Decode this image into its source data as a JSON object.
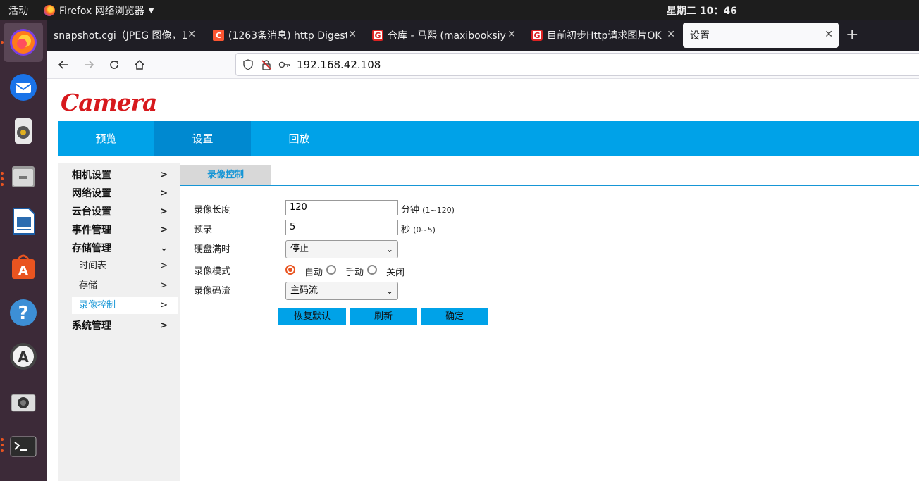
{
  "topbar": {
    "activities": "活动",
    "app_name": "Firefox 网络浏览器",
    "clock": "星期二 10：46"
  },
  "dock": {
    "items": [
      "firefox-icon",
      "thunderbird-icon",
      "rhythmbox-icon",
      "files-icon",
      "libreoffice-writer-icon",
      "software-center-icon",
      "help-icon",
      "software-updater-icon",
      "camera-icon",
      "terminal-icon"
    ]
  },
  "browser": {
    "tabs": [
      {
        "label": "snapshot.cgi（JPEG 图像，1",
        "favicon": ""
      },
      {
        "label": "(1263条消息) http Digest",
        "favicon": "C"
      },
      {
        "label": "仓库 - 马熙 (maxibooksiy",
        "favicon": "G"
      },
      {
        "label": "目前初步Http请求图片OK",
        "favicon": "G"
      },
      {
        "label": "设置",
        "favicon": ""
      }
    ],
    "url": "192.168.42.108"
  },
  "page": {
    "logo": "Camera",
    "main_nav": [
      "预览",
      "设置",
      "回放"
    ],
    "sidebar": {
      "items": [
        "相机设置",
        "网络设置",
        "云台设置",
        "事件管理",
        "存储管理",
        "系统管理"
      ],
      "storage_sub": [
        "时间表",
        "存储",
        "录像控制"
      ]
    },
    "subtab": "录像控制",
    "form": {
      "length_label": "录像长度",
      "length_value": "120",
      "length_unit": "分钟",
      "length_range": "(1~120)",
      "prerecord_label": "预录",
      "prerecord_value": "5",
      "prerecord_unit": "秒",
      "prerecord_range": "(0~5)",
      "disk_full_label": "硬盘满时",
      "disk_full_value": "停止",
      "mode_label": "录像模式",
      "mode_options": [
        "自动",
        "手动",
        "关闭"
      ],
      "mode_selected": "自动",
      "stream_label": "录像码流",
      "stream_value": "主码流"
    },
    "buttons": {
      "restore": "恢复默认",
      "refresh": "刷新",
      "confirm": "确定"
    }
  },
  "colors": {
    "accent": "#00a2e8",
    "accent_active": "#0089d0",
    "logo": "#d7191d",
    "link_active": "#1696d6",
    "radio": "#e95420"
  }
}
